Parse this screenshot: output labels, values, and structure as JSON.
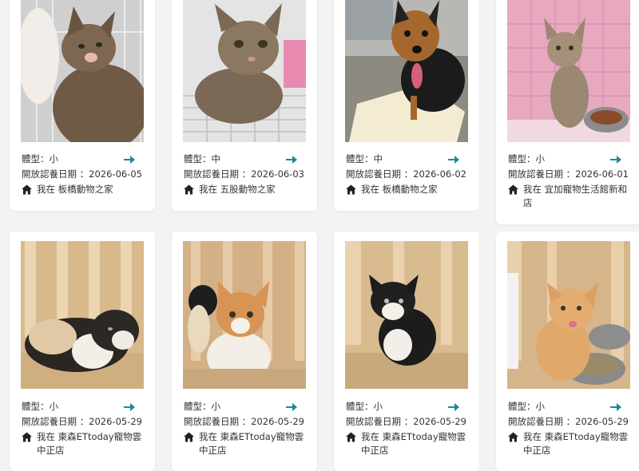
{
  "labels": {
    "size": "體型：",
    "open_date": "開放認養日期 ：",
    "location_prefix": "我在"
  },
  "colors": {
    "accent": "#1a8a9a",
    "home_icon": "#222222"
  },
  "icons": {
    "go": "arrow-right-icon",
    "home": "house-icon"
  },
  "cards": [
    {
      "size": "小",
      "date": "2026-06-05",
      "location": "板橋動物之家",
      "photo": "tabby cat held by gloved hand"
    },
    {
      "size": "中",
      "date": "2026-06-03",
      "location": "五股動物之家",
      "photo": "tabby cat lying on wire cage floor"
    },
    {
      "size": "中",
      "date": "2026-06-02",
      "location": "板橋動物之家",
      "photo": "black and tan dog on a towel"
    },
    {
      "size": "小",
      "date": "2026-06-01",
      "location": "宜加寵物生活館新和店",
      "photo": "tabby kitten by a food bowl"
    },
    {
      "size": "小",
      "date": "2026-05-29",
      "location": "東森ETtoday寵物雲中正店",
      "photo": "calico kitten"
    },
    {
      "size": "小",
      "date": "2026-05-29",
      "location": "東森ETtoday寵物雲中正店",
      "photo": "orange and white kitten"
    },
    {
      "size": "小",
      "date": "2026-05-29",
      "location": "東森ETtoday寵物雲中正店",
      "photo": "black and white kitten"
    },
    {
      "size": "小",
      "date": "2026-05-29",
      "location": "東森ETtoday寵物雲中正店",
      "photo": "orange tabby kitten by food bowls"
    }
  ]
}
